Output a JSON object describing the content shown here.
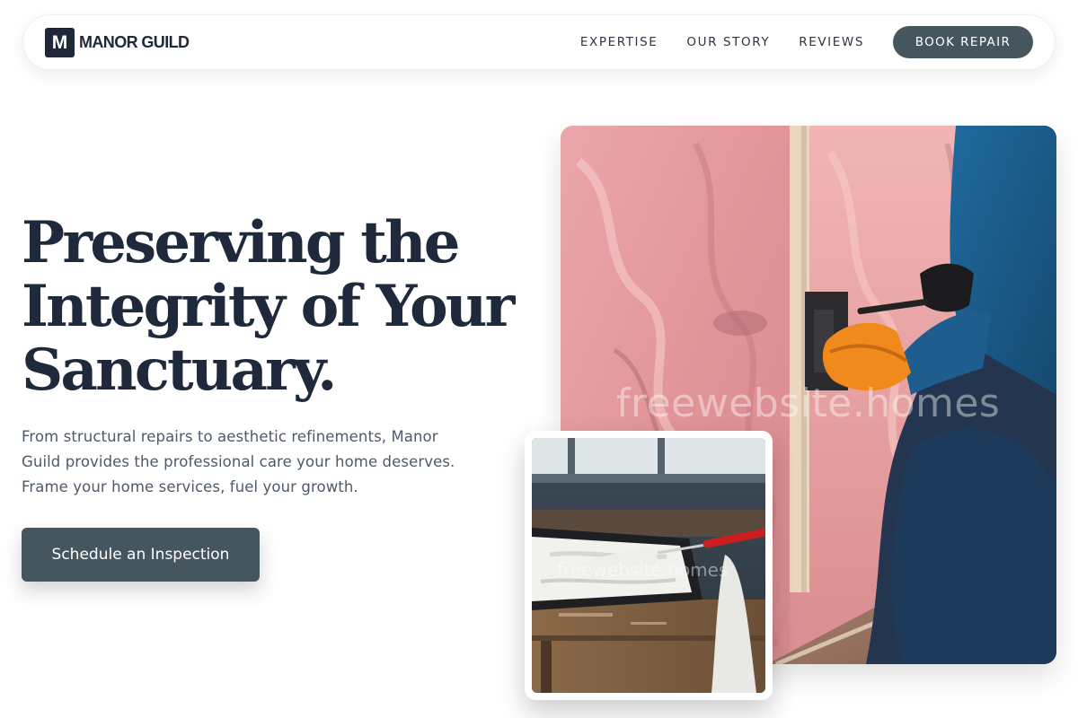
{
  "brand": {
    "logo_letter": "M",
    "name": "MANOR GUILD"
  },
  "nav": {
    "links": [
      "EXPERTISE",
      "OUR STORY",
      "REVIEWS"
    ],
    "cta": "BOOK REPAIR"
  },
  "hero": {
    "title_lines": [
      "Preserving the",
      "Integrity of Your",
      "Sanctuary."
    ],
    "subtitle_lines": [
      "From structural repairs to aesthetic refinements, Manor",
      "Guild provides the professional care your home deserves.",
      "Frame your home services, fuel your growth."
    ],
    "cta": "Schedule an Inspection"
  },
  "images": {
    "main_watermark": "freewebsite.homes",
    "inset_watermark": "freewebsite.homes"
  },
  "colors": {
    "primary": "#45565f",
    "heading": "#1e2a3b",
    "body_text": "#4d5a6a",
    "insulation_pink": "#e8a3a6",
    "worker_blue": "#1d4f7a",
    "glove_orange": "#f08a1d"
  }
}
